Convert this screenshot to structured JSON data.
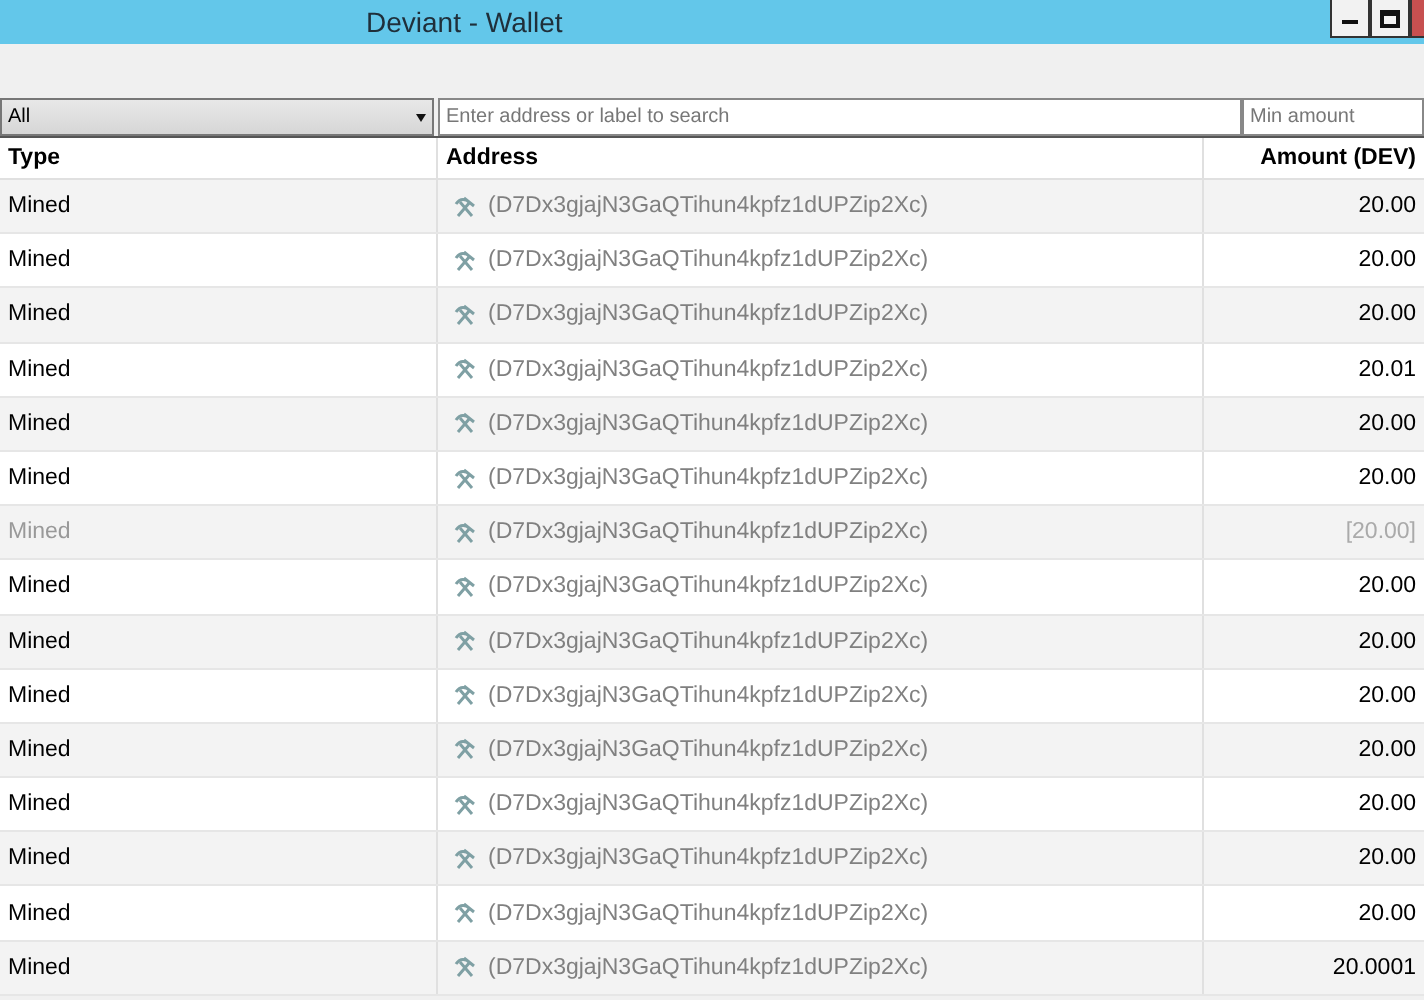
{
  "window": {
    "title": "Deviant - Wallet"
  },
  "filter": {
    "type_filter": "All",
    "search": {
      "placeholder": "Enter address or label to search"
    },
    "min_amount": {
      "placeholder": "Min amount"
    }
  },
  "table": {
    "columns": [
      "Type",
      "Address",
      "Amount (DEV)"
    ],
    "rows": [
      {
        "type": "Mined",
        "address": "(D7Dx3gjajN3GaQTihun4kpfz1dUPZip2Xc)",
        "amount": "20.00",
        "dimmed": false
      },
      {
        "type": "Mined",
        "address": "(D7Dx3gjajN3GaQTihun4kpfz1dUPZip2Xc)",
        "amount": "20.00",
        "dimmed": false
      },
      {
        "type": "Mined",
        "address": "(D7Dx3gjajN3GaQTihun4kpfz1dUPZip2Xc)",
        "amount": "20.00",
        "dimmed": false
      },
      {
        "type": "Mined",
        "address": "(D7Dx3gjajN3GaQTihun4kpfz1dUPZip2Xc)",
        "amount": "20.01",
        "dimmed": false
      },
      {
        "type": "Mined",
        "address": "(D7Dx3gjajN3GaQTihun4kpfz1dUPZip2Xc)",
        "amount": "20.00",
        "dimmed": false
      },
      {
        "type": "Mined",
        "address": "(D7Dx3gjajN3GaQTihun4kpfz1dUPZip2Xc)",
        "amount": "20.00",
        "dimmed": false
      },
      {
        "type": "Mined",
        "address": "(D7Dx3gjajN3GaQTihun4kpfz1dUPZip2Xc)",
        "amount": "[20.00]",
        "dimmed": true
      },
      {
        "type": "Mined",
        "address": "(D7Dx3gjajN3GaQTihun4kpfz1dUPZip2Xc)",
        "amount": "20.00",
        "dimmed": false
      },
      {
        "type": "Mined",
        "address": "(D7Dx3gjajN3GaQTihun4kpfz1dUPZip2Xc)",
        "amount": "20.00",
        "dimmed": false
      },
      {
        "type": "Mined",
        "address": "(D7Dx3gjajN3GaQTihun4kpfz1dUPZip2Xc)",
        "amount": "20.00",
        "dimmed": false
      },
      {
        "type": "Mined",
        "address": "(D7Dx3gjajN3GaQTihun4kpfz1dUPZip2Xc)",
        "amount": "20.00",
        "dimmed": false
      },
      {
        "type": "Mined",
        "address": "(D7Dx3gjajN3GaQTihun4kpfz1dUPZip2Xc)",
        "amount": "20.00",
        "dimmed": false
      },
      {
        "type": "Mined",
        "address": "(D7Dx3gjajN3GaQTihun4kpfz1dUPZip2Xc)",
        "amount": "20.00",
        "dimmed": false
      },
      {
        "type": "Mined",
        "address": "(D7Dx3gjajN3GaQTihun4kpfz1dUPZip2Xc)",
        "amount": "20.00",
        "dimmed": false
      },
      {
        "type": "Mined",
        "address": "(D7Dx3gjajN3GaQTihun4kpfz1dUPZip2Xc)",
        "amount": "20.0001",
        "dimmed": false
      }
    ]
  }
}
